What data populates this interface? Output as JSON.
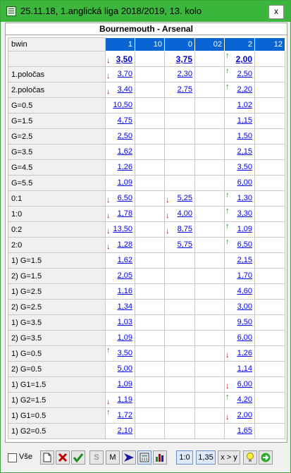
{
  "window": {
    "title": "25.11.18, 1.anglická liga 2018/2019, 13. kolo",
    "close_label": "x"
  },
  "match_title": "Bournemouth - Arsenal",
  "header": {
    "bookmaker": "bwin",
    "columns": [
      "1",
      "10",
      "0",
      "02",
      "2",
      "12"
    ]
  },
  "rows": [
    {
      "label": "",
      "cells": [
        {
          "v": "3,50",
          "a": "down",
          "b": true
        },
        {
          "v": ""
        },
        {
          "v": "3,75",
          "b": true
        },
        {
          "v": ""
        },
        {
          "v": "2,00",
          "a": "up",
          "b": true
        },
        {
          "v": ""
        }
      ]
    },
    {
      "label": "1.poločas",
      "cells": [
        {
          "v": "3,70",
          "a": "down"
        },
        {
          "v": ""
        },
        {
          "v": "2,30"
        },
        {
          "v": ""
        },
        {
          "v": "2,50",
          "a": "up"
        },
        {
          "v": ""
        }
      ]
    },
    {
      "label": "2.poločas",
      "cells": [
        {
          "v": "3,40",
          "a": "down"
        },
        {
          "v": ""
        },
        {
          "v": "2,75"
        },
        {
          "v": ""
        },
        {
          "v": "2,20",
          "a": "up"
        },
        {
          "v": ""
        }
      ]
    },
    {
      "label": "G=0.5",
      "cells": [
        {
          "v": "10,50"
        },
        {
          "v": ""
        },
        {
          "v": ""
        },
        {
          "v": ""
        },
        {
          "v": "1,02"
        },
        {
          "v": ""
        }
      ]
    },
    {
      "label": "G=1.5",
      "cells": [
        {
          "v": "4,75"
        },
        {
          "v": ""
        },
        {
          "v": ""
        },
        {
          "v": ""
        },
        {
          "v": "1,15"
        },
        {
          "v": ""
        }
      ]
    },
    {
      "label": "G=2.5",
      "cells": [
        {
          "v": "2,50"
        },
        {
          "v": ""
        },
        {
          "v": ""
        },
        {
          "v": ""
        },
        {
          "v": "1,50"
        },
        {
          "v": ""
        }
      ]
    },
    {
      "label": "G=3.5",
      "cells": [
        {
          "v": "1,62"
        },
        {
          "v": ""
        },
        {
          "v": ""
        },
        {
          "v": ""
        },
        {
          "v": "2,15"
        },
        {
          "v": ""
        }
      ]
    },
    {
      "label": "G=4.5",
      "cells": [
        {
          "v": "1,26"
        },
        {
          "v": ""
        },
        {
          "v": ""
        },
        {
          "v": ""
        },
        {
          "v": "3,50"
        },
        {
          "v": ""
        }
      ]
    },
    {
      "label": "G=5.5",
      "cells": [
        {
          "v": "1,09"
        },
        {
          "v": ""
        },
        {
          "v": ""
        },
        {
          "v": ""
        },
        {
          "v": "6,00"
        },
        {
          "v": ""
        }
      ]
    },
    {
      "label": "0:1",
      "cells": [
        {
          "v": "6,50",
          "a": "down"
        },
        {
          "v": ""
        },
        {
          "v": "5,25",
          "a": "down"
        },
        {
          "v": ""
        },
        {
          "v": "1,30",
          "a": "up"
        },
        {
          "v": ""
        }
      ]
    },
    {
      "label": "1:0",
      "cells": [
        {
          "v": "1,78",
          "a": "down"
        },
        {
          "v": ""
        },
        {
          "v": "4,00",
          "a": "down"
        },
        {
          "v": ""
        },
        {
          "v": "3,30",
          "a": "up"
        },
        {
          "v": ""
        }
      ]
    },
    {
      "label": "0:2",
      "cells": [
        {
          "v": "13,50",
          "a": "down"
        },
        {
          "v": ""
        },
        {
          "v": "8,75",
          "a": "down"
        },
        {
          "v": ""
        },
        {
          "v": "1,09",
          "a": "up"
        },
        {
          "v": ""
        }
      ]
    },
    {
      "label": "2:0",
      "cells": [
        {
          "v": "1,28",
          "a": "down"
        },
        {
          "v": ""
        },
        {
          "v": "5,75"
        },
        {
          "v": ""
        },
        {
          "v": "6,50",
          "a": "up"
        },
        {
          "v": ""
        }
      ]
    },
    {
      "label": "1) G=1.5",
      "cells": [
        {
          "v": "1,62"
        },
        {
          "v": ""
        },
        {
          "v": ""
        },
        {
          "v": ""
        },
        {
          "v": "2,15"
        },
        {
          "v": ""
        }
      ]
    },
    {
      "label": "2) G=1.5",
      "cells": [
        {
          "v": "2,05"
        },
        {
          "v": ""
        },
        {
          "v": ""
        },
        {
          "v": ""
        },
        {
          "v": "1,70"
        },
        {
          "v": ""
        }
      ]
    },
    {
      "label": "1) G=2.5",
      "cells": [
        {
          "v": "1,16"
        },
        {
          "v": ""
        },
        {
          "v": ""
        },
        {
          "v": ""
        },
        {
          "v": "4,60"
        },
        {
          "v": ""
        }
      ]
    },
    {
      "label": "2) G=2.5",
      "cells": [
        {
          "v": "1,34"
        },
        {
          "v": ""
        },
        {
          "v": ""
        },
        {
          "v": ""
        },
        {
          "v": "3,00"
        },
        {
          "v": ""
        }
      ]
    },
    {
      "label": "1) G=3.5",
      "cells": [
        {
          "v": "1,03"
        },
        {
          "v": ""
        },
        {
          "v": ""
        },
        {
          "v": ""
        },
        {
          "v": "9,50"
        },
        {
          "v": ""
        }
      ]
    },
    {
      "label": "2) G=3.5",
      "cells": [
        {
          "v": "1,09"
        },
        {
          "v": ""
        },
        {
          "v": ""
        },
        {
          "v": ""
        },
        {
          "v": "6,00"
        },
        {
          "v": ""
        }
      ]
    },
    {
      "label": "1) G=0.5",
      "cells": [
        {
          "v": "3,50",
          "a": "up"
        },
        {
          "v": ""
        },
        {
          "v": ""
        },
        {
          "v": ""
        },
        {
          "v": "1,26",
          "a": "down"
        },
        {
          "v": ""
        }
      ]
    },
    {
      "label": "2) G=0.5",
      "cells": [
        {
          "v": "5,00"
        },
        {
          "v": ""
        },
        {
          "v": ""
        },
        {
          "v": ""
        },
        {
          "v": "1,14"
        },
        {
          "v": ""
        }
      ]
    },
    {
      "label": "1) G1=1.5",
      "cells": [
        {
          "v": "1,09"
        },
        {
          "v": ""
        },
        {
          "v": ""
        },
        {
          "v": ""
        },
        {
          "v": "6,00",
          "a": "down"
        },
        {
          "v": ""
        }
      ]
    },
    {
      "label": "1) G2=1.5",
      "cells": [
        {
          "v": "1,19",
          "a": "down"
        },
        {
          "v": ""
        },
        {
          "v": ""
        },
        {
          "v": ""
        },
        {
          "v": "4,20",
          "a": "up"
        },
        {
          "v": ""
        }
      ]
    },
    {
      "label": "1) G1=0.5",
      "cells": [
        {
          "v": "1,72",
          "a": "up"
        },
        {
          "v": ""
        },
        {
          "v": ""
        },
        {
          "v": ""
        },
        {
          "v": "2,00",
          "a": "down"
        },
        {
          "v": ""
        }
      ]
    },
    {
      "label": "1) G2=0.5",
      "cells": [
        {
          "v": "2,10"
        },
        {
          "v": ""
        },
        {
          "v": ""
        },
        {
          "v": ""
        },
        {
          "v": "1,65"
        },
        {
          "v": ""
        }
      ]
    }
  ],
  "toolbar": {
    "all_checkbox_label": "Vše",
    "s_label": "S",
    "m_label": "M",
    "score_label": "1:0",
    "odds_label": "1,35",
    "compare_label": "x > y"
  },
  "colors": {
    "titlebar": "#3bb53b",
    "header_bg": "#0a64d2",
    "arrow_down": "#d40000",
    "arrow_up": "#1a8a1a",
    "odds_link": "#0000ee"
  }
}
